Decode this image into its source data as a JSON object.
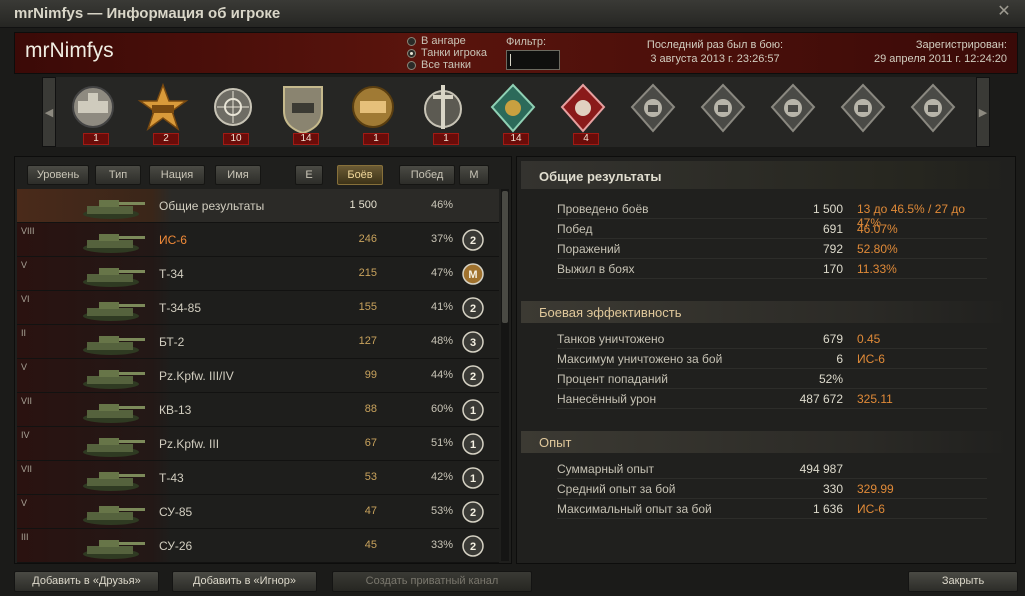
{
  "window": {
    "title": "mrNimfys — Информация об игроке"
  },
  "header": {
    "player_name": "mrNimfys",
    "radio": [
      "В ангаре",
      "Танки игрока",
      "Все танки"
    ],
    "filter_label": "Фильтр:",
    "last_battle_label": "Последний раз был в бою:",
    "last_battle_value": "3 августа 2013 г. 23:26:57",
    "registered_label": "Зарегистрирован:",
    "registered_value": "29 апреля 2011 г. 12:24:20"
  },
  "medals": [
    {
      "icon": "tank-expert-medal-icon",
      "count": "1"
    },
    {
      "icon": "gold-star-medal-icon",
      "count": "2"
    },
    {
      "icon": "sniper-medal-icon",
      "count": "10"
    },
    {
      "icon": "defender-badge-icon",
      "count": "14"
    },
    {
      "icon": "medal-of-honor-icon",
      "count": "1"
    },
    {
      "icon": "sword-medal-icon",
      "count": "1"
    },
    {
      "icon": "green-diamond-medal-icon",
      "count": "14"
    },
    {
      "icon": "red-diamond-medal-icon",
      "count": "4"
    },
    {
      "icon": "locked-medal-icon",
      "count": ""
    },
    {
      "icon": "locked-medal-icon",
      "count": ""
    },
    {
      "icon": "locked-medal-icon",
      "count": ""
    },
    {
      "icon": "locked-medal-icon",
      "count": ""
    },
    {
      "icon": "locked-medal-icon",
      "count": ""
    }
  ],
  "sort": {
    "level": "Уровень",
    "type": "Тип",
    "nation": "Нация",
    "name": "Имя",
    "e": "Е",
    "battles": "Боёв",
    "wins": "Побед",
    "m": "М"
  },
  "rows": [
    {
      "tier": "",
      "name": "Общие результаты",
      "battles": "1 500",
      "wins": "46%",
      "mastery": ""
    },
    {
      "tier": "VIII",
      "name": "ИС-6",
      "battles": "246",
      "wins": "37%",
      "mastery": "2"
    },
    {
      "tier": "V",
      "name": "Т-34",
      "battles": "215",
      "wins": "47%",
      "mastery": "M"
    },
    {
      "tier": "VI",
      "name": "Т-34-85",
      "battles": "155",
      "wins": "41%",
      "mastery": "2"
    },
    {
      "tier": "II",
      "name": "БТ-2",
      "battles": "127",
      "wins": "48%",
      "mastery": "3"
    },
    {
      "tier": "V",
      "name": "Pz.Kpfw. III/IV",
      "battles": "99",
      "wins": "44%",
      "mastery": "2"
    },
    {
      "tier": "VII",
      "name": "КВ-13",
      "battles": "88",
      "wins": "60%",
      "mastery": "1"
    },
    {
      "tier": "IV",
      "name": "Pz.Kpfw. III",
      "battles": "67",
      "wins": "51%",
      "mastery": "1"
    },
    {
      "tier": "VII",
      "name": "Т-43",
      "battles": "53",
      "wins": "42%",
      "mastery": "1"
    },
    {
      "tier": "V",
      "name": "СУ-85",
      "battles": "47",
      "wins": "53%",
      "mastery": "2"
    },
    {
      "tier": "III",
      "name": "СУ-26",
      "battles": "45",
      "wins": "33%",
      "mastery": "2"
    }
  ],
  "right": {
    "general_title": "Общие результаты",
    "general": [
      {
        "label": "Проведено боёв",
        "value": "1 500",
        "extra": "13 до 46.5% / 27 до 47%"
      },
      {
        "label": "Побед",
        "value": "691",
        "extra": "46.07%"
      },
      {
        "label": "Поражений",
        "value": "792",
        "extra": "52.80%"
      },
      {
        "label": "Выжил в боях",
        "value": "170",
        "extra": "11.33%"
      }
    ],
    "efficiency_title": "Боевая эффективность",
    "efficiency": [
      {
        "label": "Танков уничтожено",
        "value": "679",
        "extra": "0.45"
      },
      {
        "label": "Максимум уничтожено за бой",
        "value": "6",
        "extra": "ИС-6"
      },
      {
        "label": "Процент попаданий",
        "value": "52%",
        "extra": ""
      },
      {
        "label": "Нанесённый урон",
        "value": "487 672",
        "extra": "325.11"
      }
    ],
    "experience_title": "Опыт",
    "experience": [
      {
        "label": "Суммарный опыт",
        "value": "494 987",
        "extra": ""
      },
      {
        "label": "Средний опыт за бой",
        "value": "330",
        "extra": "329.99"
      },
      {
        "label": "Максимальный опыт за бой",
        "value": "1 636",
        "extra": "ИС-6"
      }
    ]
  },
  "buttons": {
    "add_friend": "Добавить в «Друзья»",
    "add_ignore": "Добавить в «Игнор»",
    "private_channel": "Создать приватный канал",
    "close": "Закрыть"
  },
  "colors": {
    "accent_orange": "#e08a38",
    "header_red": "#5a140d",
    "badge_red": "#6a0c09"
  }
}
